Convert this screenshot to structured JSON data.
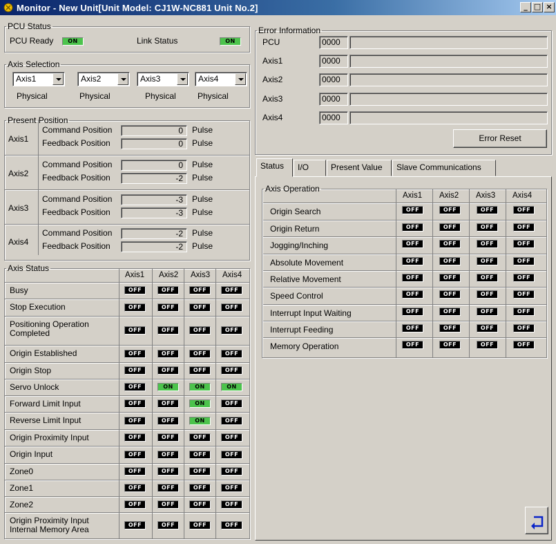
{
  "window": {
    "title": "Monitor - New Unit[Unit Model: CJ1W-NC881 Unit No.2]",
    "minimize": "_",
    "maximize": "□",
    "close": "×"
  },
  "pcu_status": {
    "legend": "PCU Status",
    "pcu_ready_label": "PCU Ready",
    "pcu_ready_state": "ON",
    "link_status_label": "Link Status",
    "link_status_state": "ON"
  },
  "axis_selection": {
    "legend": "Axis Selection",
    "combos": [
      "Axis1",
      "Axis2",
      "Axis3",
      "Axis4"
    ],
    "types": [
      "Physical",
      "Physical",
      "Physical",
      "Physical"
    ]
  },
  "present_position": {
    "legend": "Present Position",
    "command_label": "Command Position",
    "feedback_label": "Feedback Position",
    "unit": "Pulse",
    "axes": [
      {
        "name": "Axis1",
        "command": "0",
        "feedback": "0"
      },
      {
        "name": "Axis2",
        "command": "0",
        "feedback": "-2"
      },
      {
        "name": "Axis3",
        "command": "-3",
        "feedback": "-3"
      },
      {
        "name": "Axis4",
        "command": "-2",
        "feedback": "-2"
      }
    ]
  },
  "axis_status": {
    "legend": "Axis Status",
    "columns": [
      "Axis1",
      "Axis2",
      "Axis3",
      "Axis4"
    ],
    "rows": [
      {
        "label": "Busy",
        "states": [
          "OFF",
          "OFF",
          "OFF",
          "OFF"
        ]
      },
      {
        "label": "Stop Execution",
        "states": [
          "OFF",
          "OFF",
          "OFF",
          "OFF"
        ]
      },
      {
        "label": "Positioning Operation",
        "label2": "Completed",
        "states": [
          "OFF",
          "OFF",
          "OFF",
          "OFF"
        ]
      },
      {
        "label": "Origin Established",
        "states": [
          "OFF",
          "OFF",
          "OFF",
          "OFF"
        ]
      },
      {
        "label": "Origin Stop",
        "states": [
          "OFF",
          "OFF",
          "OFF",
          "OFF"
        ]
      },
      {
        "label": "Servo Unlock",
        "states": [
          "OFF",
          "ON",
          "ON",
          "ON"
        ]
      },
      {
        "label": "Forward Limit Input",
        "states": [
          "OFF",
          "OFF",
          "ON",
          "OFF"
        ]
      },
      {
        "label": "Reverse Limit Input",
        "states": [
          "OFF",
          "OFF",
          "ON",
          "OFF"
        ]
      },
      {
        "label": "Origin Proximity Input",
        "states": [
          "OFF",
          "OFF",
          "OFF",
          "OFF"
        ]
      },
      {
        "label": "Origin Input",
        "states": [
          "OFF",
          "OFF",
          "OFF",
          "OFF"
        ]
      },
      {
        "label": "Zone0",
        "states": [
          "OFF",
          "OFF",
          "OFF",
          "OFF"
        ]
      },
      {
        "label": "Zone1",
        "states": [
          "OFF",
          "OFF",
          "OFF",
          "OFF"
        ]
      },
      {
        "label": "Zone2",
        "states": [
          "OFF",
          "OFF",
          "OFF",
          "OFF"
        ]
      },
      {
        "label": "Origin Proximity Input",
        "label2": "Internal Memory Area",
        "states": [
          "OFF",
          "OFF",
          "OFF",
          "OFF"
        ]
      }
    ]
  },
  "error_information": {
    "legend": "Error Information",
    "rows": [
      {
        "label": "PCU",
        "code": "0000",
        "message": ""
      },
      {
        "label": "Axis1",
        "code": "0000",
        "message": ""
      },
      {
        "label": "Axis2",
        "code": "0000",
        "message": ""
      },
      {
        "label": "Axis3",
        "code": "0000",
        "message": ""
      },
      {
        "label": "Axis4",
        "code": "0000",
        "message": ""
      }
    ],
    "reset_button": "Error Reset"
  },
  "tabs": [
    "Status",
    "I/O",
    "Present Value",
    "Slave Communications"
  ],
  "axis_operation": {
    "legend": "Axis Operation",
    "columns": [
      "Axis1",
      "Axis2",
      "Axis3",
      "Axis4"
    ],
    "rows": [
      {
        "label": "Origin Search",
        "states": [
          "OFF",
          "OFF",
          "OFF",
          "OFF"
        ]
      },
      {
        "label": "Origin Return",
        "states": [
          "OFF",
          "OFF",
          "OFF",
          "OFF"
        ]
      },
      {
        "label": "Jogging/Inching",
        "states": [
          "OFF",
          "OFF",
          "OFF",
          "OFF"
        ]
      },
      {
        "label": "Absolute Movement",
        "states": [
          "OFF",
          "OFF",
          "OFF",
          "OFF"
        ]
      },
      {
        "label": "Relative Movement",
        "states": [
          "OFF",
          "OFF",
          "OFF",
          "OFF"
        ]
      },
      {
        "label": "Speed Control",
        "states": [
          "OFF",
          "OFF",
          "OFF",
          "OFF"
        ]
      },
      {
        "label": "Interrupt Input Waiting",
        "states": [
          "OFF",
          "OFF",
          "OFF",
          "OFF"
        ]
      },
      {
        "label": "Interrupt Feeding",
        "states": [
          "OFF",
          "OFF",
          "OFF",
          "OFF"
        ]
      },
      {
        "label": "Memory Operation",
        "states": [
          "OFF",
          "OFF",
          "OFF",
          "OFF"
        ]
      }
    ]
  },
  "return_button_icon": "return-arrow-icon",
  "colors": {
    "on": "#4cc34c",
    "off": "#000000",
    "title_start": "#0a246a",
    "title_end": "#a6caf0",
    "face": "#d4d0c8"
  }
}
